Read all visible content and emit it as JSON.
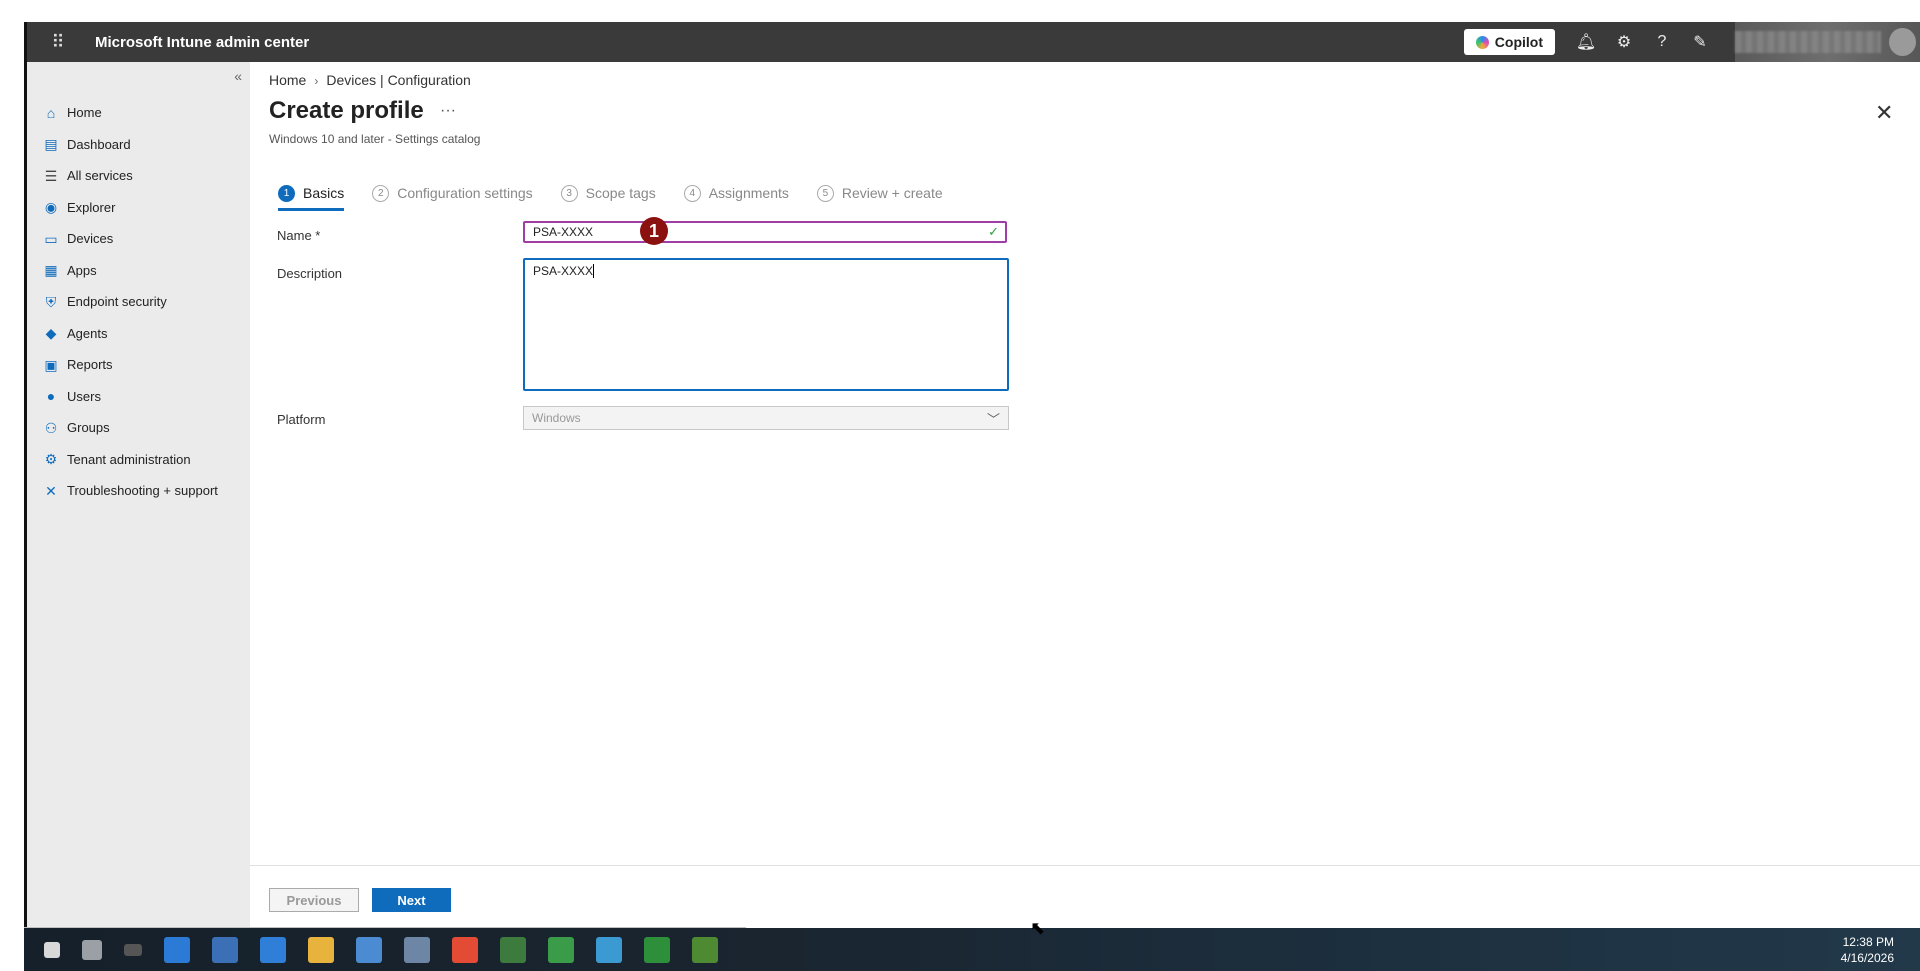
{
  "topbar": {
    "title": "Microsoft Intune admin center",
    "copilot_label": "Copilot",
    "icons": [
      "bell-icon",
      "gear-icon",
      "help-icon",
      "feedback-icon"
    ]
  },
  "sidebar": {
    "items": [
      {
        "label": "Home",
        "icon": "home-icon",
        "color": "#0f6cbd"
      },
      {
        "label": "Dashboard",
        "icon": "dashboard-icon",
        "color": "#0f6cbd"
      },
      {
        "label": "All services",
        "icon": "list-icon",
        "color": "#444444"
      },
      {
        "label": "Explorer",
        "icon": "explorer-icon",
        "color": "#0f6cbd"
      },
      {
        "label": "Devices",
        "icon": "devices-icon",
        "color": "#0f6cbd"
      },
      {
        "label": "Apps",
        "icon": "apps-icon",
        "color": "#0f6cbd"
      },
      {
        "label": "Endpoint security",
        "icon": "shield-icon",
        "color": "#0f6cbd"
      },
      {
        "label": "Agents",
        "icon": "agents-icon",
        "color": "#0f6cbd"
      },
      {
        "label": "Reports",
        "icon": "reports-icon",
        "color": "#0f6cbd"
      },
      {
        "label": "Users",
        "icon": "user-icon",
        "color": "#0f6cbd"
      },
      {
        "label": "Groups",
        "icon": "groups-icon",
        "color": "#0f6cbd"
      },
      {
        "label": "Tenant administration",
        "icon": "tenant-icon",
        "color": "#0f6cbd"
      },
      {
        "label": "Troubleshooting + support",
        "icon": "wrench-icon",
        "color": "#0f6cbd"
      }
    ]
  },
  "breadcrumb": {
    "home": "Home",
    "current": "Devices | Configuration"
  },
  "page": {
    "title": "Create profile",
    "more": "···",
    "subtitle": "Windows 10 and later - Settings catalog"
  },
  "steps": [
    {
      "num": "1",
      "label": "Basics"
    },
    {
      "num": "2",
      "label": "Configuration settings"
    },
    {
      "num": "3",
      "label": "Scope tags"
    },
    {
      "num": "4",
      "label": "Assignments"
    },
    {
      "num": "5",
      "label": "Review + create"
    }
  ],
  "form": {
    "name_label": "Name *",
    "name_value": "PSA-XXXX",
    "description_label": "Description",
    "description_value": "PSA-XXXX",
    "platform_label": "Platform",
    "platform_value": "Windows"
  },
  "annotation": {
    "badge": "1"
  },
  "footer": {
    "previous": "Previous",
    "next": "Next"
  },
  "taskbar": {
    "time": "12:38 PM",
    "date": "4/16/2026"
  }
}
